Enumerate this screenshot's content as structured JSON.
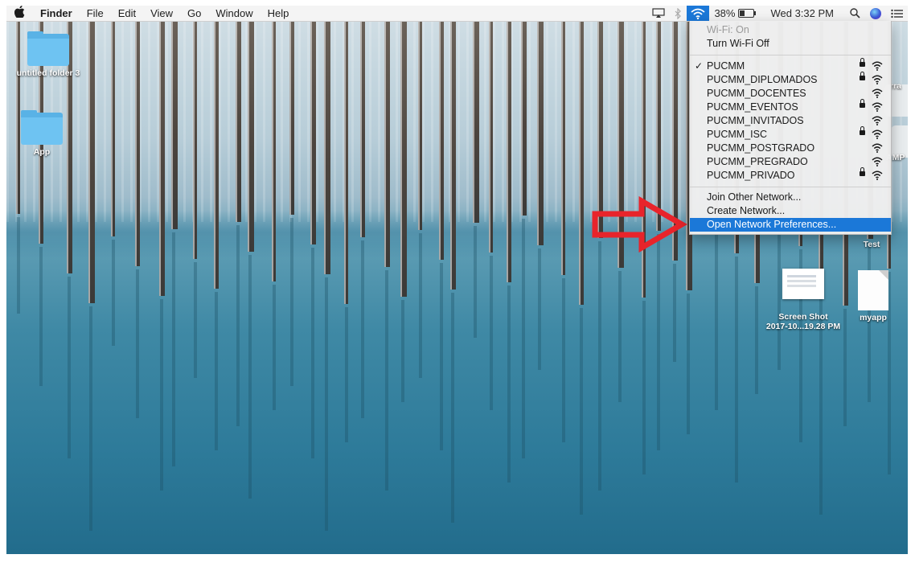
{
  "menubar": {
    "apple_icon": "apple-logo",
    "app_name": "Finder",
    "menus": [
      "File",
      "Edit",
      "View",
      "Go",
      "Window",
      "Help"
    ],
    "battery_percent": "38%",
    "clock": "Wed 3:32 PM",
    "tray_icons": [
      "airplay-icon",
      "bluetooth-icon",
      "wifi-icon",
      "battery-icon",
      "search-icon",
      "siri-icon",
      "notification-list-icon"
    ]
  },
  "wifi_menu": {
    "status": "Wi-Fi: On",
    "toggle": "Turn Wi-Fi Off",
    "networks": [
      {
        "name": "PUCMM",
        "connected": true,
        "locked": true
      },
      {
        "name": "PUCMM_DIPLOMADOS",
        "connected": false,
        "locked": true
      },
      {
        "name": "PUCMM_DOCENTES",
        "connected": false,
        "locked": false
      },
      {
        "name": "PUCMM_EVENTOS",
        "connected": false,
        "locked": true
      },
      {
        "name": "PUCMM_INVITADOS",
        "connected": false,
        "locked": false
      },
      {
        "name": "PUCMM_ISC",
        "connected": false,
        "locked": true
      },
      {
        "name": "PUCMM_POSTGRADO",
        "connected": false,
        "locked": false
      },
      {
        "name": "PUCMM_PREGRADO",
        "connected": false,
        "locked": false
      },
      {
        "name": "PUCMM_PRIVADO",
        "connected": false,
        "locked": true
      }
    ],
    "actions": [
      "Join Other Network...",
      "Create Network...",
      "Open Network Preferences..."
    ],
    "highlighted_action": "Open Network Preferences...",
    "highlight_color": "#1b78d8"
  },
  "desktop": {
    "icons": [
      {
        "label": "untitled folder 3",
        "kind": "folder"
      },
      {
        "label": "App",
        "kind": "folder"
      },
      {
        "label": "Screen Shot\n2017-10...19.28 PM",
        "kind": "screenshot"
      },
      {
        "label": "myapp",
        "kind": "document"
      },
      {
        "label": "Test",
        "kind": "partial"
      }
    ],
    "edge_labels": [
      "rra",
      "AMP"
    ]
  },
  "annotation": {
    "arrow_color": "#e8242b"
  }
}
